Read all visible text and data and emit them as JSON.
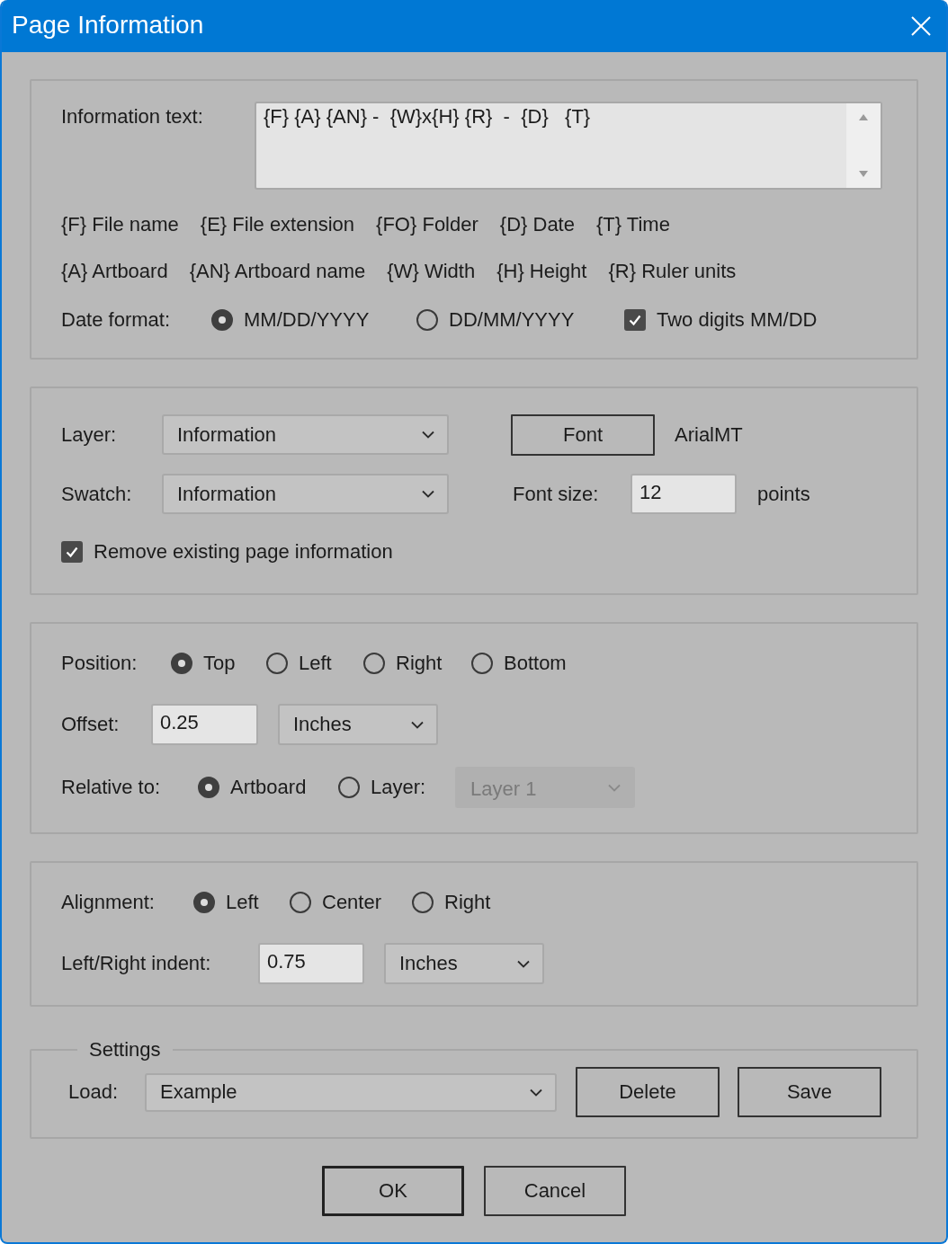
{
  "window": {
    "title": "Page Information"
  },
  "information_text": {
    "label": "Information text:",
    "value": "{F} {A} {AN} -  {W}x{H} {R}  -  {D}   {T}"
  },
  "token_rows": [
    [
      "{F} File name",
      "{E} File extension",
      "{FO} Folder",
      "{D} Date",
      "{T} Time"
    ],
    [
      "{A} Artboard",
      "{AN} Artboard name",
      "{W} Width",
      "{H} Height",
      "{R} Ruler units"
    ]
  ],
  "date_format": {
    "label": "Date format:",
    "options": [
      {
        "label": "MM/DD/YYYY",
        "selected": true
      },
      {
        "label": "DD/MM/YYYY",
        "selected": false
      }
    ],
    "two_digits": {
      "label": "Two digits MM/DD",
      "checked": true
    }
  },
  "layer": {
    "label": "Layer:",
    "value": "Information"
  },
  "font": {
    "button": "Font",
    "name": "ArialMT"
  },
  "swatch": {
    "label": "Swatch:",
    "value": "Information"
  },
  "font_size": {
    "label": "Font size:",
    "value": "12",
    "unit": "points"
  },
  "remove_existing": {
    "label": "Remove existing page information",
    "checked": true
  },
  "position": {
    "label": "Position:",
    "options": [
      {
        "label": "Top",
        "selected": true
      },
      {
        "label": "Left",
        "selected": false
      },
      {
        "label": "Right",
        "selected": false
      },
      {
        "label": "Bottom",
        "selected": false
      }
    ]
  },
  "offset": {
    "label": "Offset:",
    "value": "0.25",
    "unit": "Inches"
  },
  "relative_to": {
    "label": "Relative to:",
    "options": [
      {
        "label": "Artboard",
        "selected": true
      },
      {
        "label": "Layer:",
        "selected": false
      }
    ],
    "layer_select": {
      "value": "Layer 1",
      "disabled": true
    }
  },
  "alignment": {
    "label": "Alignment:",
    "options": [
      {
        "label": "Left",
        "selected": true
      },
      {
        "label": "Center",
        "selected": false
      },
      {
        "label": "Right",
        "selected": false
      }
    ]
  },
  "indent": {
    "label": "Left/Right indent:",
    "value": "0.75",
    "unit": "Inches"
  },
  "settings": {
    "title": "Settings",
    "load_label": "Load:",
    "load_value": "Example",
    "buttons": [
      "Delete",
      "Save"
    ]
  },
  "buttons": [
    {
      "label": "OK",
      "default": true
    },
    {
      "label": "Cancel",
      "default": false
    }
  ]
}
